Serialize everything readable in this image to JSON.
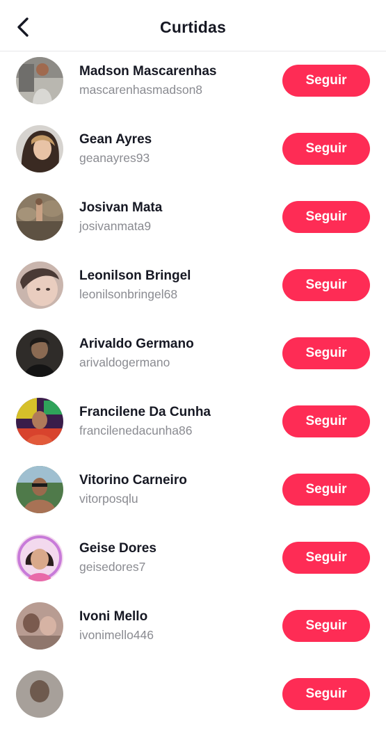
{
  "header": {
    "title": "Curtidas",
    "back_icon": "chevron-left-icon"
  },
  "colors": {
    "accent": "#fe2c55",
    "text_primary": "#161823",
    "text_secondary": "#8a8b91",
    "divider": "#e6e6e8"
  },
  "users": [
    {
      "name": "Madson Mascarenhas",
      "handle": "mascarenhasmadson8",
      "button": "Seguir"
    },
    {
      "name": "Gean Ayres",
      "handle": "geanayres93",
      "button": "Seguir"
    },
    {
      "name": "Josivan Mata",
      "handle": "josivanmata9",
      "button": "Seguir"
    },
    {
      "name": "Leonilson Bringel",
      "handle": "leonilsonbringel68",
      "button": "Seguir"
    },
    {
      "name": "Arivaldo Germano",
      "handle": "arivaldogermano",
      "button": "Seguir"
    },
    {
      "name": "Francilene Da Cunha",
      "handle": "francilenedacunha86",
      "button": "Seguir"
    },
    {
      "name": "Vitorino Carneiro",
      "handle": "vitorposqlu",
      "button": "Seguir"
    },
    {
      "name": "Geise Dores",
      "handle": "geisedores7",
      "button": "Seguir"
    },
    {
      "name": "Ivoni Mello",
      "handle": "ivonimello446",
      "button": "Seguir"
    },
    {
      "name": "",
      "handle": "",
      "button": "Seguir"
    }
  ]
}
